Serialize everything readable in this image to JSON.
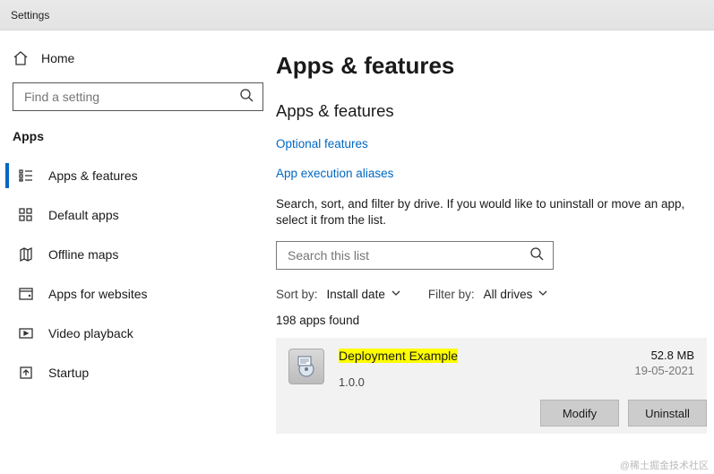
{
  "window": {
    "title": "Settings"
  },
  "sidebar": {
    "home_label": "Home",
    "search_placeholder": "Find a setting",
    "section_title": "Apps",
    "items": [
      {
        "label": "Apps & features",
        "icon": "apps-features-icon",
        "selected": true
      },
      {
        "label": "Default apps",
        "icon": "default-apps-icon",
        "selected": false
      },
      {
        "label": "Offline maps",
        "icon": "offline-maps-icon",
        "selected": false
      },
      {
        "label": "Apps for websites",
        "icon": "apps-websites-icon",
        "selected": false
      },
      {
        "label": "Video playback",
        "icon": "video-playback-icon",
        "selected": false
      },
      {
        "label": "Startup",
        "icon": "startup-icon",
        "selected": false
      }
    ]
  },
  "main": {
    "heading": "Apps & features",
    "subheading": "Apps & features",
    "links": {
      "optional_features": "Optional features",
      "app_exec_aliases": "App execution aliases"
    },
    "help_text": "Search, sort, and filter by drive. If you would like to uninstall or move an app, select it from the list.",
    "list_search_placeholder": "Search this list",
    "sort": {
      "label": "Sort by:",
      "value": "Install date"
    },
    "filter": {
      "label": "Filter by:",
      "value": "All drives"
    },
    "count_text": "198 apps found",
    "selected_app": {
      "name": "Deployment Example",
      "version": "1.0.0",
      "size": "52.8 MB",
      "date": "19-05-2021",
      "modify_label": "Modify",
      "uninstall_label": "Uninstall"
    }
  },
  "watermark": "@稀土掘金技术社区"
}
